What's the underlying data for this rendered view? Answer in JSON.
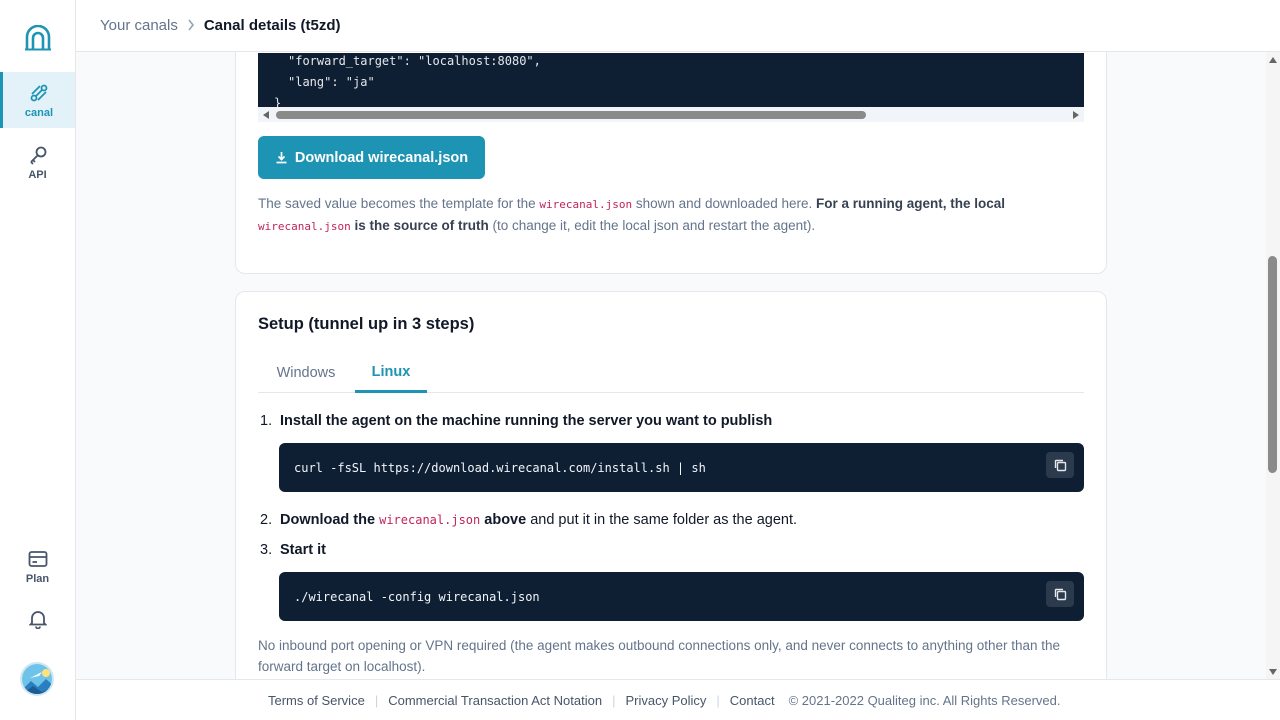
{
  "breadcrumb": {
    "parent": "Your canals",
    "current": "Canal details (t5zd)"
  },
  "sidebar": {
    "items": [
      {
        "label": "canal",
        "icon": "canal-icon",
        "active": true
      },
      {
        "label": "API",
        "icon": "key-icon",
        "active": false
      },
      {
        "label": "Plan",
        "icon": "card-icon",
        "active": false
      }
    ]
  },
  "config": {
    "json_lines": [
      "\"forward_target\": \"localhost:8080\",",
      "\"lang\": \"ja\"",
      "}"
    ],
    "download_label": "Download wirecanal.json",
    "note": {
      "part1": "The saved value becomes the template for the ",
      "code1": "wirecanal.json",
      "part2": " shown and downloaded here. ",
      "bold1": "For a running agent, the local",
      "code2": "wirecanal.json",
      "bold2": " is the source of truth",
      "part3": " (to change it, edit the local json and restart the agent)."
    }
  },
  "setup": {
    "title": "Setup (tunnel up in 3 steps)",
    "tabs": [
      "Windows",
      "Linux"
    ],
    "active_tab": "Linux",
    "step1": {
      "num": "1.",
      "text": "Install the agent on the machine running the server you want to publish"
    },
    "cmd1": "curl -fsSL https://download.wirecanal.com/install.sh | sh",
    "step2": {
      "num": "2.",
      "bold_a": "Download the ",
      "code": "wirecanal.json",
      "bold_b": " above",
      "rest": " and put it in the same folder as the agent."
    },
    "step3": {
      "num": "3.",
      "text": "Start it"
    },
    "cmd2": "./wirecanal -config wirecanal.json",
    "footnote": "No inbound port opening or VPN required (the agent makes outbound connections only, and never connects to anything other than the forward target on localhost)."
  },
  "footer": {
    "terms": "Terms of Service",
    "commercial": "Commercial Transaction Act Notation",
    "privacy": "Privacy Policy",
    "contact": "Contact",
    "copyright": "© 2021-2022 Qualiteg inc. All Rights Reserved."
  },
  "colors": {
    "accent": "#1e94b4",
    "code_bg": "#0f1f33",
    "inline_code": "#c0245d"
  }
}
